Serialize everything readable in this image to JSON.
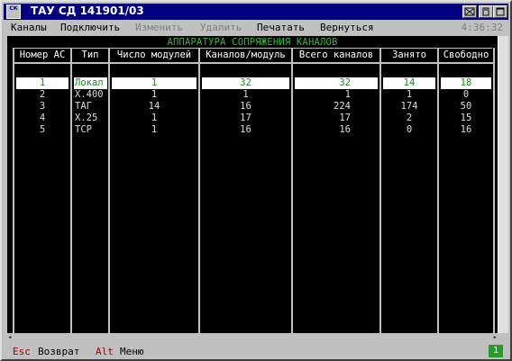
{
  "window": {
    "title": "ТАУ СД 141901/03",
    "icon_text": "СК"
  },
  "menu": {
    "items": [
      {
        "label": "Каналы",
        "enabled": true
      },
      {
        "label": "Подключить",
        "enabled": true
      },
      {
        "label": "Изменить",
        "enabled": false
      },
      {
        "label": "Удалить",
        "enabled": false
      },
      {
        "label": "Печатать",
        "enabled": true
      },
      {
        "label": "Вернуться",
        "enabled": true
      }
    ],
    "clock": "4:36:32"
  },
  "screen": {
    "title": "АППАРАТУРА СОПРЯЖЕНИЯ КАНАЛОВ",
    "columns": [
      "Номер АС",
      "Тип",
      "Число модулей",
      "Каналов/модуль",
      "Всего каналов",
      "Занято",
      "Свободно"
    ],
    "rows": [
      [
        "1",
        "Локал",
        "1",
        "32",
        "32",
        "14",
        "18"
      ],
      [
        "2",
        "X.400",
        "1",
        "1",
        "1",
        "1",
        "0"
      ],
      [
        "3",
        "ТАГ",
        "14",
        "16",
        "224",
        "174",
        "50"
      ],
      [
        "4",
        "X.25",
        "1",
        "17",
        "17",
        "2",
        "15"
      ],
      [
        "5",
        "TCP",
        "1",
        "16",
        "16",
        "0",
        "16"
      ]
    ],
    "selected_row": 0
  },
  "statusbar": {
    "key1": "Esc",
    "label1": "Возврат",
    "key2": "Alt",
    "label2": "Меню",
    "badge": "1"
  },
  "colors": {
    "title_bar": "#000080",
    "screen_bg": "#000000",
    "heading_green": "#3ab53a",
    "hotkey_red": "#a00000"
  }
}
